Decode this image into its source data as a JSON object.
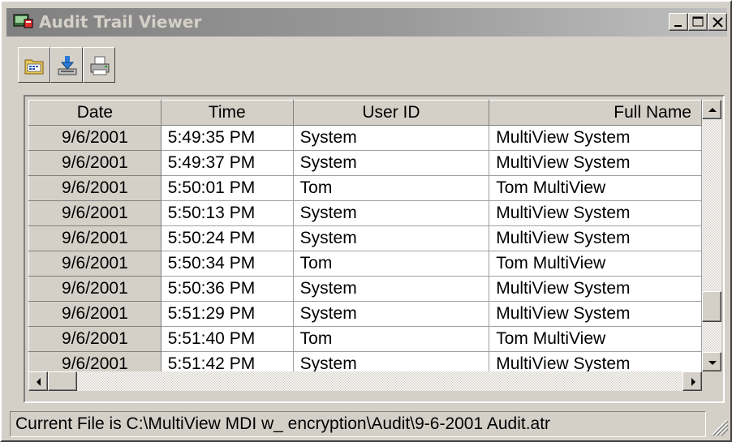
{
  "window": {
    "title": "Audit Trail Viewer",
    "minimize_icon": "minimize-icon",
    "restore_icon": "maximize-icon",
    "close_icon": "close-icon"
  },
  "toolbar": {
    "buttons": [
      {
        "name": "open-file",
        "icon": "folder-open-icon"
      },
      {
        "name": "export",
        "icon": "download-tray-icon"
      },
      {
        "name": "print",
        "icon": "printer-icon"
      }
    ]
  },
  "grid": {
    "columns": [
      "Date",
      "Time",
      "User ID",
      "Full Name"
    ],
    "rows": [
      [
        "9/6/2001",
        "5:49:35 PM",
        "System",
        "MultiView System"
      ],
      [
        "9/6/2001",
        "5:49:37 PM",
        "System",
        "MultiView System"
      ],
      [
        "9/6/2001",
        "5:50:01 PM",
        "Tom",
        "Tom MultiView"
      ],
      [
        "9/6/2001",
        "5:50:13 PM",
        "System",
        "MultiView System"
      ],
      [
        "9/6/2001",
        "5:50:24 PM",
        "System",
        "MultiView System"
      ],
      [
        "9/6/2001",
        "5:50:34 PM",
        "Tom",
        "Tom MultiView"
      ],
      [
        "9/6/2001",
        "5:50:36 PM",
        "System",
        "MultiView System"
      ],
      [
        "9/6/2001",
        "5:51:29 PM",
        "System",
        "MultiView System"
      ],
      [
        "9/6/2001",
        "5:51:40 PM",
        "Tom",
        "Tom MultiView"
      ],
      [
        "9/6/2001",
        "5:51:42 PM",
        "System",
        "MultiView System"
      ]
    ],
    "vertical_scroll_position": 0.85,
    "horizontal_scroll_position": 0.0
  },
  "status": {
    "text": "Current File is C:\\MultiView MDI w_ encryption\\Audit\\9-6-2001 Audit.atr"
  },
  "colors": {
    "face": "#d4d0c8",
    "title_inactive_start": "#808080",
    "title_inactive_end": "#c0c0c0",
    "title_text": "#d4d0c8"
  }
}
